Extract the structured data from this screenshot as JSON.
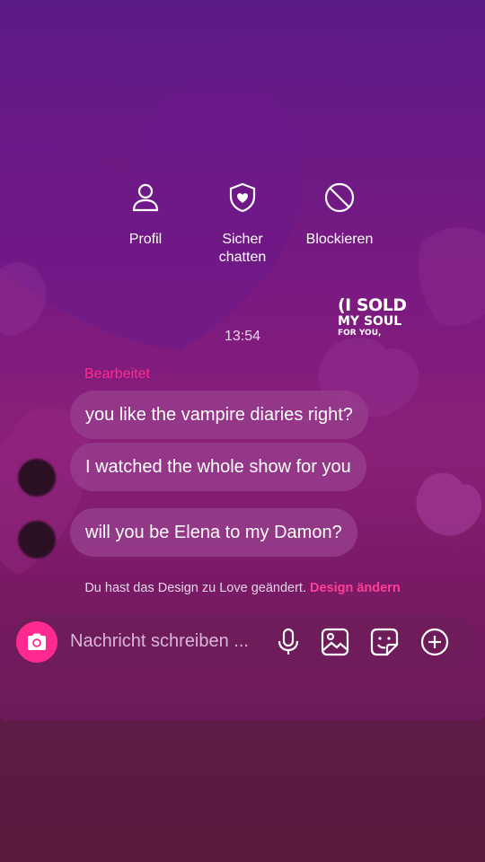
{
  "actions": [
    {
      "label": "Profil",
      "icon": "person-icon"
    },
    {
      "label": "Sicher\nchatten",
      "icon": "shield-heart-icon"
    },
    {
      "label": "Blockieren",
      "icon": "block-icon"
    }
  ],
  "sticker": {
    "line1": "(I SOLD",
    "line2": "MY SOUL",
    "line3": "FOR YOU,"
  },
  "timestamp": "13:54",
  "edited_label": "Bearbeitet",
  "messages": [
    "you like the vampire diaries right?",
    "I watched the whole show for you",
    "will you be Elena to my Damon?"
  ],
  "notice": {
    "text": "Du hast das Design zu Love geändert.",
    "link": "Design ändern"
  },
  "composer": {
    "placeholder": "Nachricht schreiben ..."
  },
  "colors": {
    "accent": "#ff2a8f",
    "bubble": "#963c8c",
    "background_top": "#5a1a86",
    "background_bottom": "#5a1a3c"
  }
}
